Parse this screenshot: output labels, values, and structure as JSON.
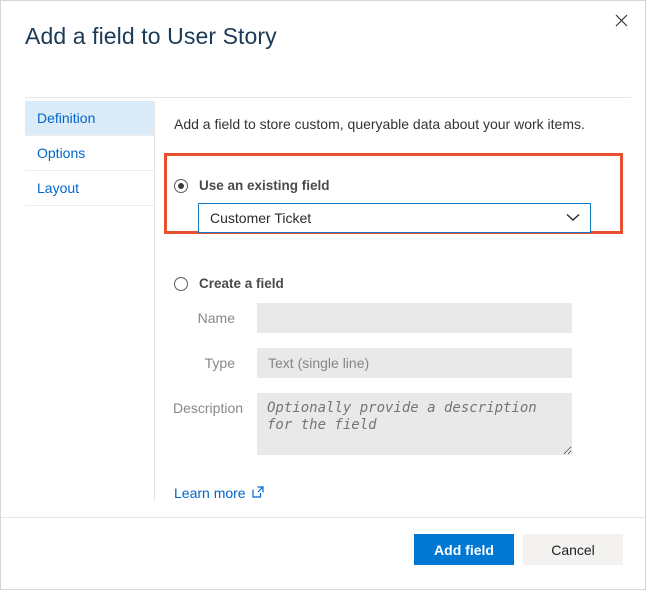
{
  "dialog": {
    "title": "Add a field to User Story",
    "close_icon": "close-icon"
  },
  "sidebar": {
    "items": [
      {
        "label": "Definition",
        "selected": true
      },
      {
        "label": "Options",
        "selected": false
      },
      {
        "label": "Layout",
        "selected": false
      }
    ]
  },
  "main": {
    "intro": "Add a field to store custom, queryable data about your work items.",
    "existing": {
      "radio_label": "Use an existing field",
      "selected": true,
      "dropdown_value": "Customer Ticket",
      "dropdown_icon": "chevron-down-icon",
      "highlight_color": "#e8502f",
      "focus_border_color": "#0f79c4"
    },
    "create": {
      "radio_label": "Create a field",
      "selected": false,
      "fields": [
        {
          "label": "Name",
          "value": "",
          "placeholder": "",
          "type": "text",
          "disabled": true
        },
        {
          "label": "Type",
          "value": "Text (single line)",
          "placeholder": "",
          "type": "select",
          "disabled": true
        },
        {
          "label": "Description",
          "value": "",
          "placeholder": "Optionally provide a description for the field",
          "type": "textarea",
          "disabled": true
        }
      ]
    },
    "learn_more": {
      "label": "Learn more",
      "icon": "external-link-icon"
    }
  },
  "footer": {
    "primary_label": "Add field",
    "secondary_label": "Cancel",
    "primary_color": "#0078d4"
  }
}
